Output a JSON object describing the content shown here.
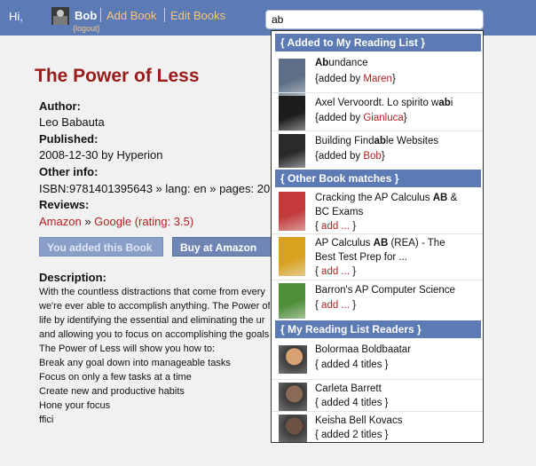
{
  "header": {
    "greeting": "Hi,",
    "user_name": "Bob",
    "logout_label": "{logout}",
    "nav": [
      "Add Book",
      "Edit Books"
    ],
    "search_value": "ab"
  },
  "book": {
    "title": "The Power of Less",
    "author_label": "Author:",
    "author": "Leo Babauta",
    "published_label": "Published:",
    "published": "2008-12-30 by Hyperion",
    "other_label": "Other info:",
    "other": "ISBN:9781401395643 » lang: en » pages: 20",
    "reviews_label": "Reviews:",
    "reviews_amazon": "Amazon",
    "reviews_sep": " » ",
    "reviews_google": "Google (rating: 3.5)",
    "added_button": "You added this Book",
    "buy_button": "Buy at Amazon",
    "description_label": "Description:",
    "description_lines": [
      "With the countless distractions that come from every",
      "we're ever able to accomplish anything. The Power of",
      "life by identifying the essential and eliminating the ur",
      "and allowing you to focus on accomplishing the goals",
      "The Power of Less will show you how to:",
      "Break any goal down into manageable tasks",
      "Focus on only a few tasks at a time",
      "Create new and productive habits",
      "Hone your focus",
      "                   ffici"
    ]
  },
  "dropdown": {
    "sections": [
      {
        "heading": "{ Added to My Reading List }",
        "items": [
          {
            "pre": "",
            "bold": "Ab",
            "post": "undance",
            "line2": "",
            "sub_pre": "{added by ",
            "sub_name": "Maren",
            "sub_post": "}",
            "thumb_color": "#5d6f86"
          },
          {
            "pre": "Axel Vervoordt. Lo spirito w",
            "bold": "ab",
            "post": "i",
            "line2": "",
            "sub_pre": "{added by ",
            "sub_name": "Gianluca",
            "sub_post": "}",
            "thumb_color": "#1d1d1d"
          },
          {
            "pre": "Building Find",
            "bold": "ab",
            "post": "le Websites",
            "line2": "",
            "sub_pre": "{added by ",
            "sub_name": "Bob",
            "sub_post": "}",
            "thumb_color": "#2a2a2a"
          }
        ]
      },
      {
        "heading": "{ Other Book matches }",
        "items": [
          {
            "pre": "Cracking the AP Calculus ",
            "bold": "AB",
            "post": " &",
            "line2": "BC Exams",
            "sub_pre": "{ ",
            "sub_name": "add ...",
            "sub_post": " }",
            "thumb_color": "#c43a3a"
          },
          {
            "pre": "AP Calculus ",
            "bold": "AB",
            "post": " (REA) - The",
            "line2": "Best Test Prep for ...",
            "sub_pre": "{ ",
            "sub_name": "add ...",
            "sub_post": " }",
            "thumb_color": "#d8a11e"
          },
          {
            "pre": "Barron's AP Computer Science",
            "bold": "",
            "post": "",
            "line2": "",
            "sub_pre": "{ ",
            "sub_name": "add ...",
            "sub_post": " }",
            "thumb_color": "#4f8f3a"
          }
        ]
      },
      {
        "heading": "{ My Reading List Readers }",
        "items": [
          {
            "pre": "Bolormaa Boldbaatar",
            "bold": "",
            "post": "",
            "line2": "",
            "sub_pre": "{ added 4 titles }",
            "sub_name": "",
            "sub_post": "",
            "thumb_color": "#d9a273"
          },
          {
            "pre": "Carleta Barrett",
            "bold": "",
            "post": "",
            "line2": "",
            "sub_pre": "{ added 4 titles }",
            "sub_name": "",
            "sub_post": "",
            "thumb_color": "#8a6a55"
          },
          {
            "pre": "Keisha Bell Kovacs",
            "bold": "",
            "post": "",
            "line2": "",
            "sub_pre": "{ added 2 titles }",
            "sub_name": "",
            "sub_post": "",
            "thumb_color": "#6d5244"
          }
        ]
      }
    ]
  },
  "colors": {
    "header_bar": "#5c7ab3",
    "title_red": "#9b1b1b",
    "link_red": "#b32020",
    "nav_orange": "#f8c67a"
  }
}
